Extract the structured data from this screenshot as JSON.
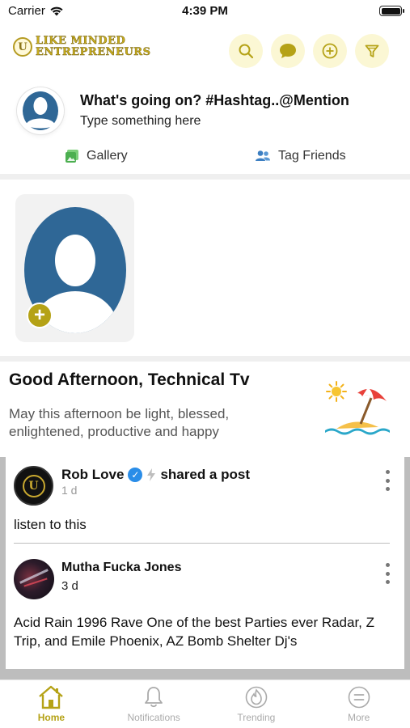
{
  "status_bar": {
    "carrier": "Carrier",
    "time": "4:39 PM"
  },
  "header": {
    "logo_line1": "Like Minded",
    "logo_line2": "Entrepreneurs",
    "logo_mark": "U",
    "actions": [
      "search-icon",
      "chat-icon",
      "add-icon",
      "filter-icon"
    ]
  },
  "composer": {
    "title": "What's going on? #Hashtag..@Mention",
    "subtitle": "Type something here",
    "gallery_label": "Gallery",
    "tag_friends_label": "Tag Friends"
  },
  "greeting": {
    "title": "Good Afternoon, Technical Tv",
    "message": "May this afternoon be light, blessed, enlightened, productive and happy"
  },
  "post": {
    "author": "Rob Love",
    "action": "shared a post",
    "time": "1 d",
    "text": "listen to this",
    "avatar_mark": "U",
    "shared": {
      "author": "Mutha Fucka Jones",
      "time": "3 d",
      "text": "Acid Rain 1996 Rave One of the best Parties ever Radar, Z Trip, and Emile Phoenix, AZ Bomb Shelter Dj's"
    }
  },
  "tabs": [
    {
      "label": "Home",
      "icon": "home-icon",
      "active": true
    },
    {
      "label": "Notifications",
      "icon": "bell-icon",
      "active": false
    },
    {
      "label": "Trending",
      "icon": "flame-icon",
      "active": false
    },
    {
      "label": "More",
      "icon": "menu-icon",
      "active": false
    }
  ],
  "colors": {
    "accent": "#b5a216",
    "accent_bg": "#fbf7d4",
    "avatar_blue": "#2f6796",
    "verified": "#2a8de8"
  }
}
